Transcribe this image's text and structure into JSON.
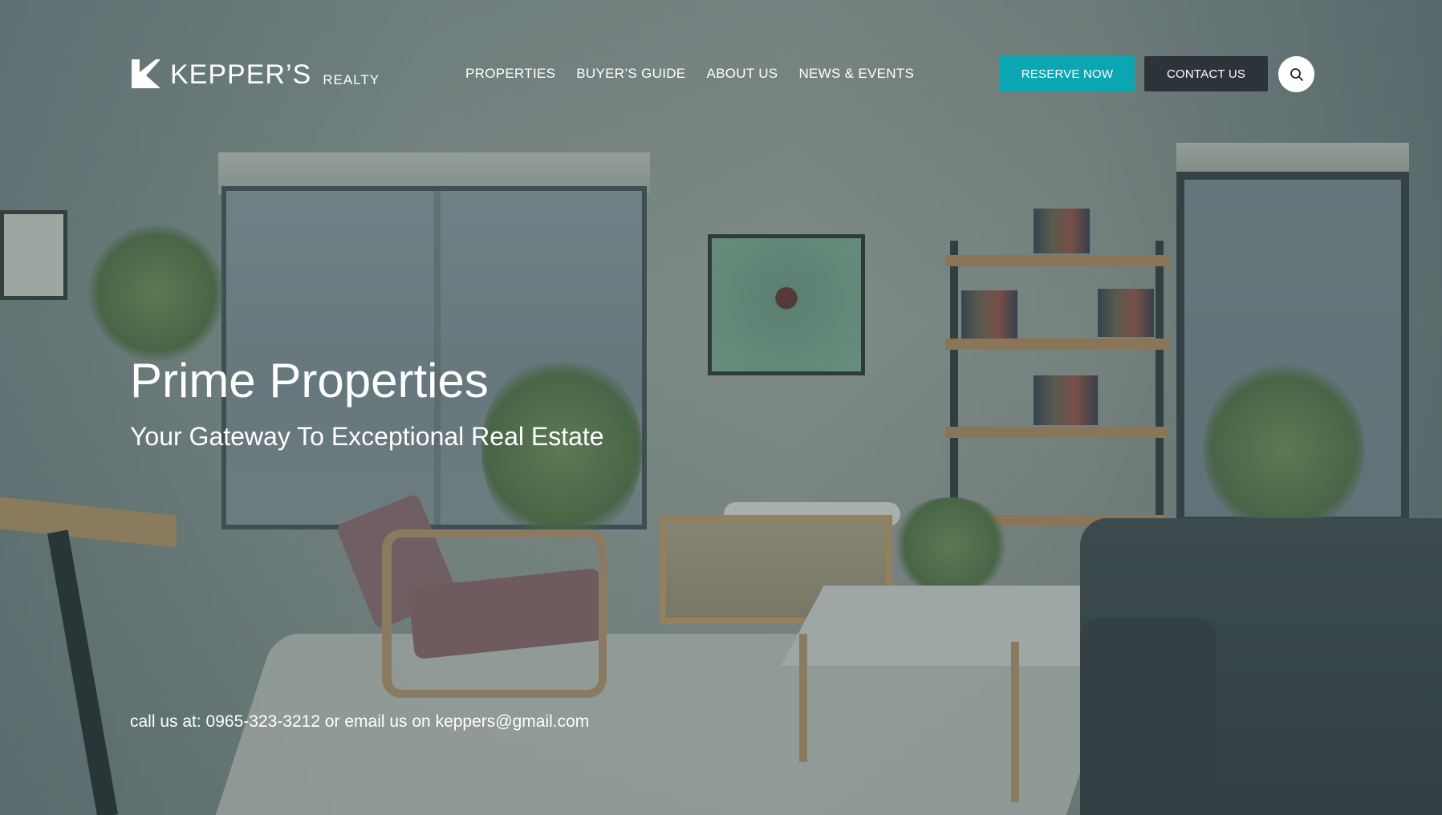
{
  "brand": {
    "name": "KEPPER’S",
    "sub": "REALTY"
  },
  "nav": {
    "items": [
      {
        "label": "PROPERTIES"
      },
      {
        "label": "BUYER’S GUIDE"
      },
      {
        "label": "ABOUT US"
      },
      {
        "label": "NEWS & EVENTS"
      }
    ]
  },
  "actions": {
    "reserve_label": "RESERVE NOW",
    "contact_label": "CONTACT US",
    "search_icon": "search-icon"
  },
  "hero": {
    "title": "Prime Properties",
    "subtitle": "Your Gateway To Exceptional Real Estate",
    "contact_line": "call us at: 0965-323-3212 or email us on keppers@gmail.com"
  },
  "colors": {
    "accent": "#0aa7b3",
    "dark_button": "#2d3439",
    "overlay": "#40565c"
  }
}
